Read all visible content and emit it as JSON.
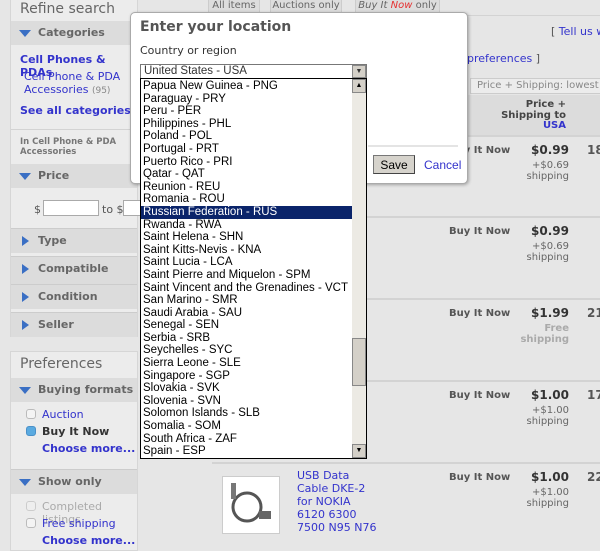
{
  "tabs": [
    "All items",
    "Auctions only",
    "Buy It",
    "Now",
    "only"
  ],
  "sidebar": {
    "title": "Refine search",
    "categories_label": "Categories",
    "cat_main": "Cell Phones & PDAs",
    "cat_sub": "Cell Phone & PDA Accessories",
    "cat_sub_count": "(95)",
    "see_all": "See all categories",
    "in_label": "In Cell Phone & PDA Accessories",
    "price_label": "Price",
    "price_from": "$",
    "price_to": "to $",
    "facets": [
      "Type",
      "Compatible Brand",
      "Condition",
      "Seller"
    ],
    "prefs_title": "Preferences",
    "buying_formats": "Buying formats",
    "auction": "Auction",
    "buy_it_now": "Buy It Now",
    "choose_more": "Choose more...",
    "show_only": "Show only",
    "completed": "Completed listings",
    "free_shipping": "Free shipping",
    "choose_more2": "Choose more..."
  },
  "main": {
    "tell_us": "Tell us wh",
    "preferences": "preferences",
    "sort": "Price + Shipping: lowest first",
    "col_price": "Price + Shipping to",
    "col_country": "USA",
    "rows": [
      {
        "format": "Buy It Now",
        "price": "$0.99",
        "ship": "+$0.69",
        "ship2": "shipping",
        "extra": "18"
      },
      {
        "format": "Buy It Now",
        "price": "$0.99",
        "ship": "+$0.69",
        "ship2": "shipping",
        "extra": ""
      },
      {
        "format": "Buy It Now",
        "price": "$1.99",
        "ship": "Free",
        "ship2": "shipping",
        "extra": "21"
      },
      {
        "format": "Buy It Now",
        "price": "$1.00",
        "ship": "+$1.00",
        "ship2": "shipping",
        "extra": "17"
      },
      {
        "format": "Buy It Now",
        "price": "$1.00",
        "ship": "+$1.00",
        "ship2": "shipping",
        "extra": "22",
        "title": "USB Data Cable DKE-2 for NOKIA 6120 6300 7500 N95 N76"
      }
    ]
  },
  "dialog": {
    "title": "Enter your location",
    "label": "Country or region",
    "selected": "United States - USA",
    "save": "Save",
    "cancel": "Cancel",
    "options": [
      "Papua New Guinea - PNG",
      "Paraguay - PRY",
      "Peru - PER",
      "Philippines - PHL",
      "Poland - POL",
      "Portugal - PRT",
      "Puerto Rico - PRI",
      "Qatar - QAT",
      "Reunion - REU",
      "Romania - ROU",
      "Russian Federation - RUS",
      "Rwanda - RWA",
      "Saint Helena - SHN",
      "Saint Kitts-Nevis - KNA",
      "Saint Lucia - LCA",
      "Saint Pierre and Miquelon - SPM",
      "Saint Vincent and the Grenadines - VCT",
      "San Marino - SMR",
      "Saudi Arabia - SAU",
      "Senegal - SEN",
      "Serbia - SRB",
      "Seychelles - SYC",
      "Sierra Leone - SLE",
      "Singapore - SGP",
      "Slovakia - SVK",
      "Slovenia - SVN",
      "Solomon Islands - SLB",
      "Somalia - SOM",
      "South Africa - ZAF",
      "Spain - ESP"
    ],
    "highlighted": "Russian Federation - RUS"
  },
  "colors": {
    "link": "#3333cc",
    "highlight": "#0a246a",
    "accent": "#3a6fc4",
    "now": "#e53333"
  }
}
